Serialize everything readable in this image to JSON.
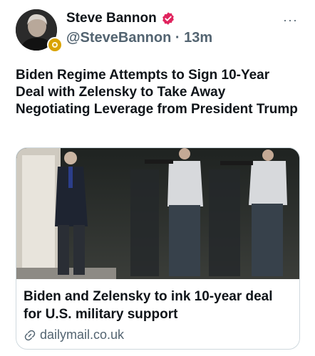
{
  "author": {
    "display_name": "Steve Bannon",
    "handle": "@SteveBannon",
    "separator": "·",
    "time_ago": "13m",
    "verified": true
  },
  "icons": {
    "verified": "verified-badge-icon",
    "affiliate": "affiliate-badge-icon",
    "more": "more-options-icon",
    "link": "link-icon"
  },
  "colors": {
    "verified_red": "#e0245e",
    "text_primary": "#0f1419",
    "text_secondary": "#536471",
    "border": "#cfd9de"
  },
  "tweet": {
    "text": "Biden Regime Attempts to Sign 10-Year Deal with Zelensky to Take Away Negotiating Leverage from President Trump"
  },
  "card": {
    "title": "Biden and Zelensky to ink 10-year deal for U.S. military support",
    "domain": "dailymail.co.uk"
  },
  "more_label": "···"
}
